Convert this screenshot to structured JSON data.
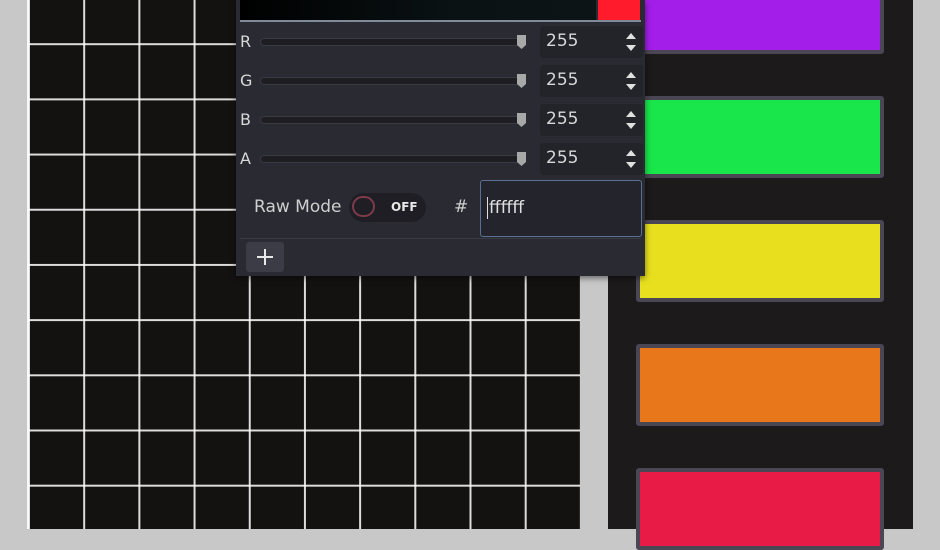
{
  "swatches": [
    {
      "name": "purple",
      "color": "#a31ee8"
    },
    {
      "name": "green",
      "color": "#19e64a"
    },
    {
      "name": "yellow",
      "color": "#e8e01e"
    },
    {
      "name": "orange",
      "color": "#e8761b"
    },
    {
      "name": "red",
      "color": "#e81b46"
    }
  ],
  "picker": {
    "current_color": "#ff1a2c",
    "channels": [
      {
        "label": "R",
        "value": "255"
      },
      {
        "label": "G",
        "value": "255"
      },
      {
        "label": "B",
        "value": "255"
      },
      {
        "label": "A",
        "value": "255"
      }
    ],
    "raw_mode_label": "Raw Mode",
    "raw_mode_state": "OFF",
    "hash_symbol": "#",
    "hex_value": "ffffff",
    "add_button_icon": "plus-icon"
  }
}
